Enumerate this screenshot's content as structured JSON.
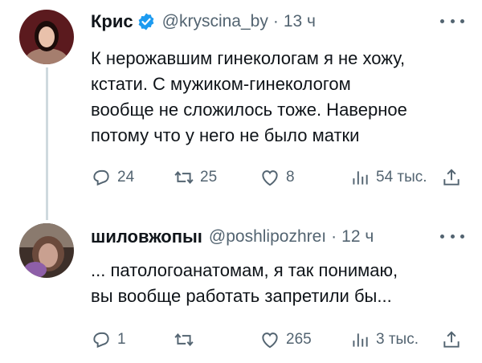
{
  "tweets": [
    {
      "name": "Крис",
      "handle": "@kryscina_by",
      "separator": "·",
      "time": "13 ч",
      "text_lines": [
        "К нерожавшим гинекологам я не хожу,",
        "кстати. С мужиком-гинекологом",
        "вообще не сложилось тоже. Наверное",
        "потому что у него не было матки"
      ],
      "replies": "24",
      "retweets": "25",
      "likes": "8",
      "views": "54 тыс."
    },
    {
      "name": "шиловжопыı",
      "handle": "@poshlipozhreı",
      "separator": "·",
      "time": "12 ч",
      "text_lines": [
        "... патологоанатомам, я так понимаю,",
        "вы вообще работать запретили бы..."
      ],
      "replies": "1",
      "retweets": "",
      "likes": "265",
      "views": "3 тыс."
    }
  ],
  "colors": {
    "verified": "#1d9bf0",
    "secondary_text": "#536471",
    "thread_line": "#cfd9de"
  },
  "icons": [
    "verified-badge-icon",
    "more-icon",
    "reply-icon",
    "retweet-icon",
    "like-icon",
    "views-icon",
    "share-icon"
  ]
}
